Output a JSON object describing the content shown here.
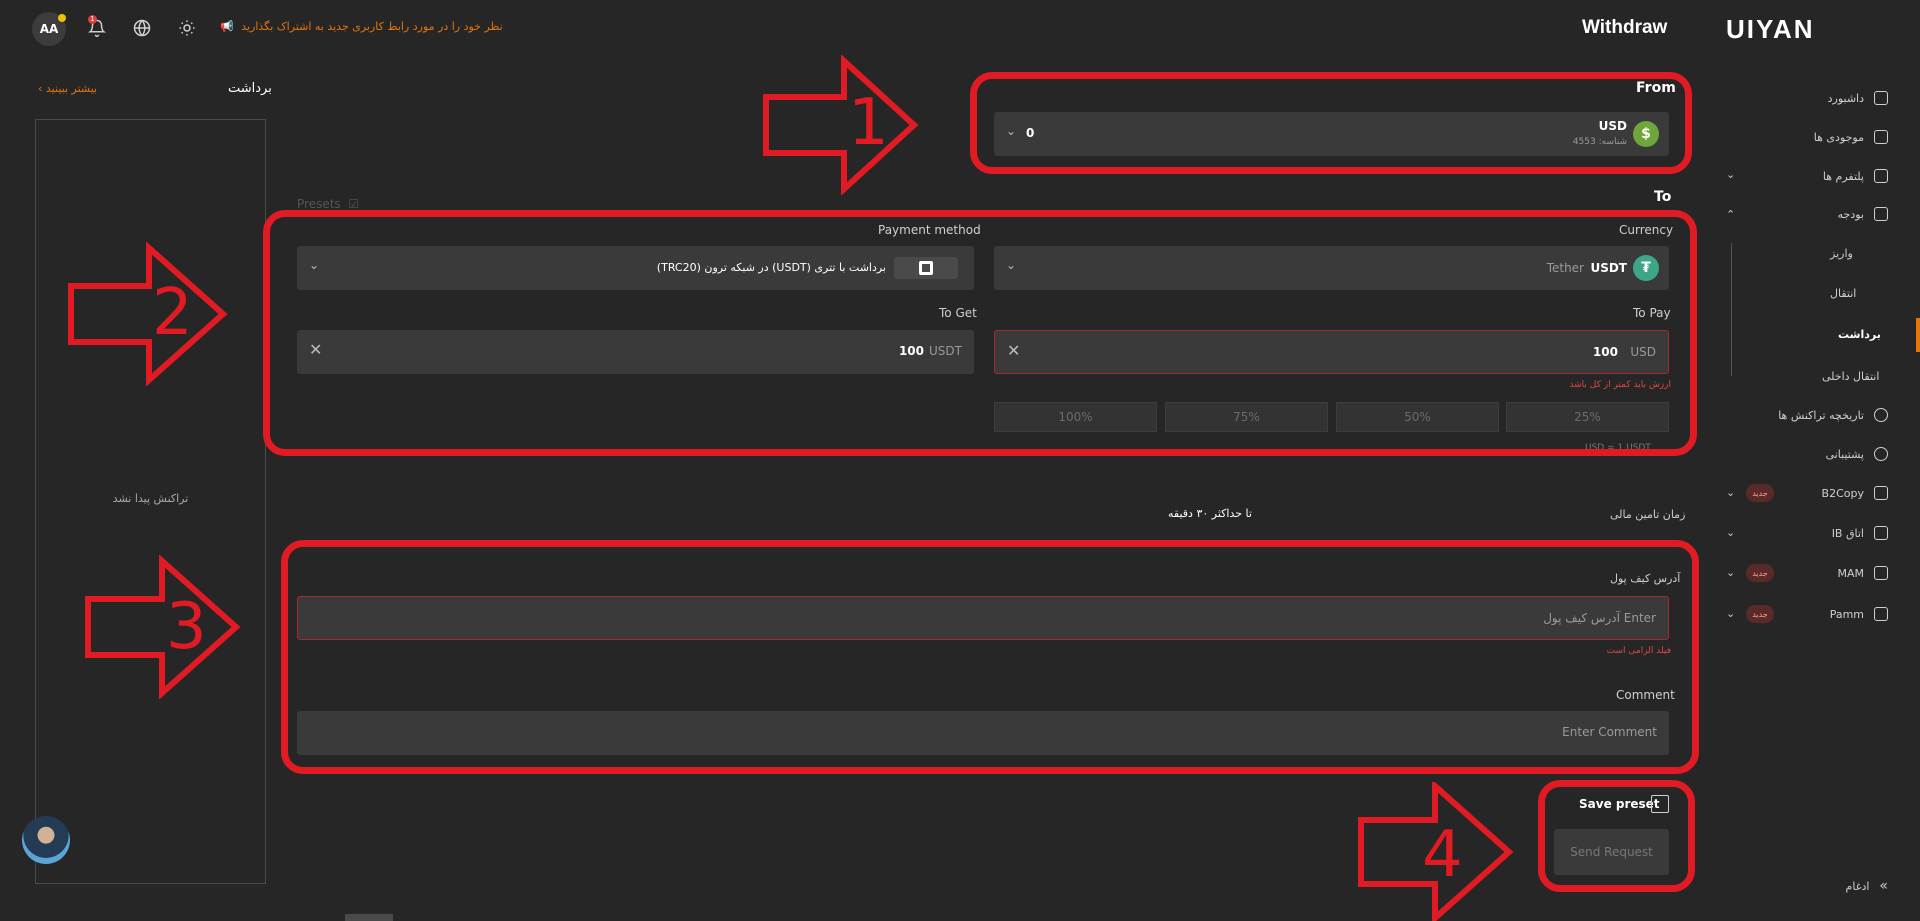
{
  "topbar": {
    "avatar_initials": "AA",
    "notification_count": "1",
    "announcement": "نظر خود را در مورد رابط کاربری جدید به اشتراک بگذارید",
    "page_title": "Withdraw",
    "logo": "UIYAN"
  },
  "left_panel": {
    "title": "برداشت",
    "more_link": "بیشتر ببینید",
    "empty_text": "تراکنش پیدا نشد"
  },
  "sidebar": {
    "items": [
      {
        "label": "داشبورد",
        "icon": "dashboard-icon"
      },
      {
        "label": "موجودی ها",
        "icon": "wallet-icon"
      },
      {
        "label": "پلتفرم ها",
        "icon": "layers-icon"
      },
      {
        "label": "بودجه",
        "icon": "transfer-icon"
      },
      {
        "label": "واریز"
      },
      {
        "label": "انتقال"
      },
      {
        "label": "برداشت"
      },
      {
        "label": "انتقال داخلی"
      },
      {
        "label": "تاریخچه تراکنش ها",
        "icon": "history-icon"
      },
      {
        "label": "پشتیبانی",
        "icon": "headset-icon"
      },
      {
        "label": "B2Copy",
        "icon": "copy-icon",
        "badge": "جدید"
      },
      {
        "label": "اتاق IB",
        "icon": "ib-icon"
      },
      {
        "label": "MAM",
        "icon": "cube-icon",
        "badge": "جدید"
      },
      {
        "label": "Pamm",
        "icon": "pamm-icon",
        "badge": "جدید"
      }
    ],
    "collapse_label": "ادغام"
  },
  "form": {
    "from_label": "From",
    "from_account": {
      "currency": "USD",
      "account": "شناسه: 4553",
      "balance": "0",
      "coin_symbol": "$"
    },
    "presets_label": "Presets",
    "to_label": "To",
    "currency_label": "Currency",
    "currency": {
      "code": "USDT",
      "name": "Tether",
      "coin_symbol": "₮"
    },
    "payment_method_label": "Payment method",
    "payment_method": "برداشت با تتری (USDT) در شبکه ترون (TRC20)",
    "to_pay_label": "To Pay",
    "to_pay": {
      "value": "100",
      "unit": "USD"
    },
    "to_pay_error": "ارزش باید کمتر از کل باشد",
    "to_get_label": "To Get",
    "to_get": {
      "value": "100",
      "unit": "USDT"
    },
    "percent_options": [
      "25%",
      "50%",
      "75%",
      "100%"
    ],
    "fee_row": "USD = 1 USDT",
    "funding_time_label": "زمان تامین مالی",
    "funding_time_value": "تا حداکثر ۳۰ دقیقه",
    "wallet_address_label": "آدرس کیف پول",
    "wallet_address_placeholder": "Enter آدرس کیف پول",
    "wallet_address_error": "فیلد الزامی است",
    "comment_label": "Comment",
    "comment_placeholder": "Enter Comment",
    "save_preset_label": "Save preset",
    "send_button": "Send Request"
  },
  "annotations": [
    "1",
    "2",
    "3",
    "4"
  ],
  "colors": {
    "accent": "#e5740d",
    "annotation_red": "#e01b24",
    "error": "#e04747"
  }
}
